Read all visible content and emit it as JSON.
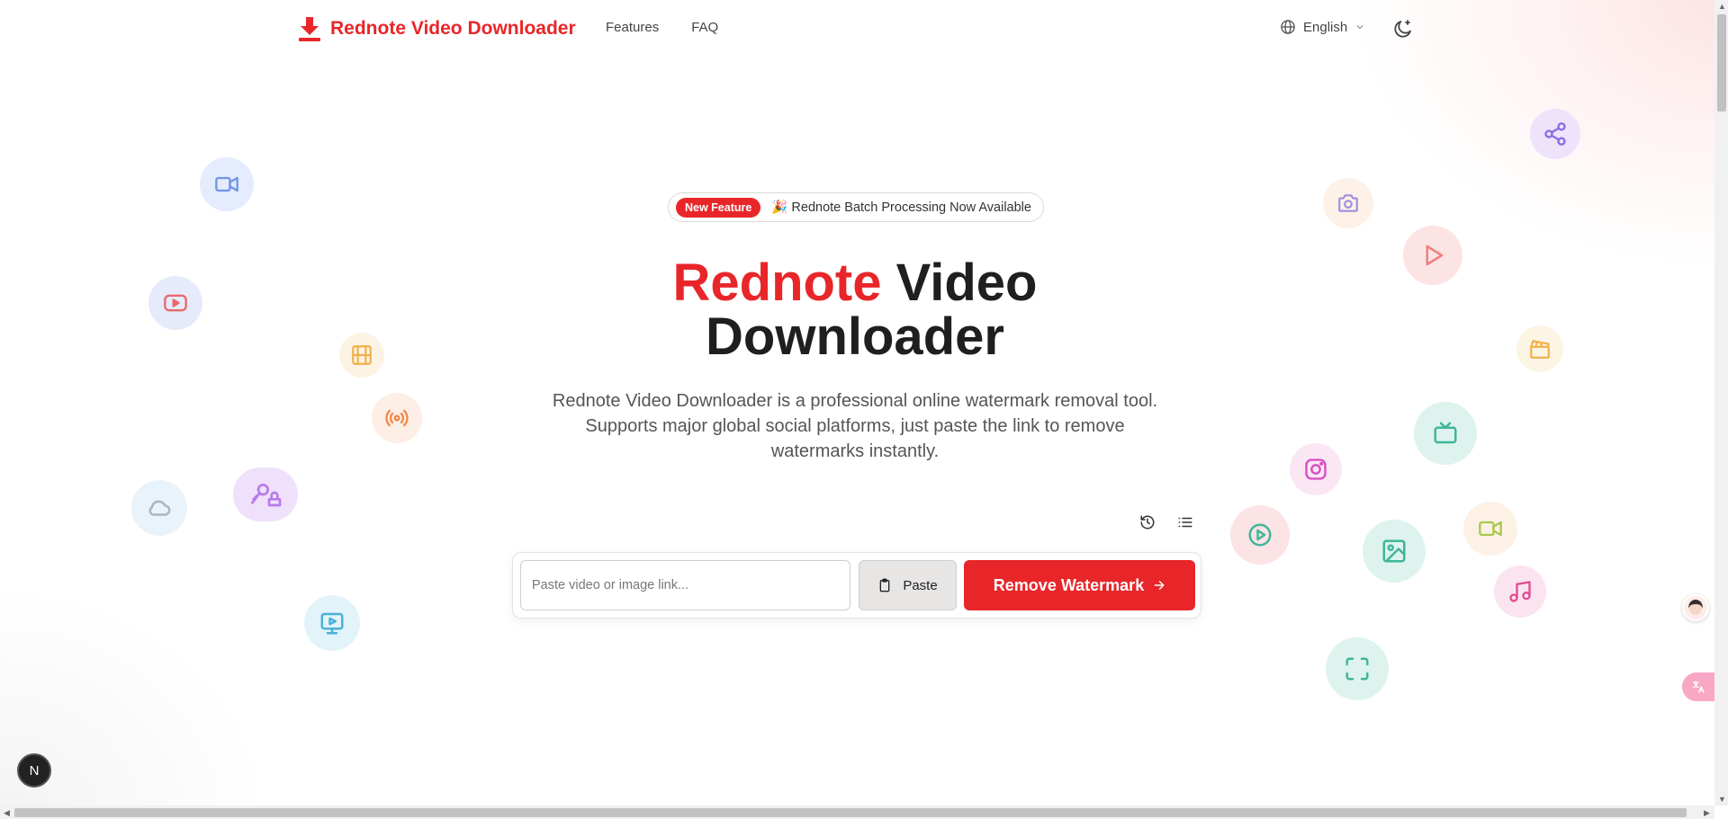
{
  "header": {
    "logo_text": "Rednote Video Downloader",
    "nav": [
      {
        "label": "Features"
      },
      {
        "label": "FAQ"
      }
    ],
    "language": "English"
  },
  "hero": {
    "badge_label": "New Feature",
    "badge_text": "🎉 Rednote Batch Processing Now Available",
    "title_red": "Rednote",
    "title_rest": " Video Downloader",
    "description": "Rednote Video Downloader is a professional online watermark removal tool. Supports major global social platforms, just paste the link to remove watermarks instantly."
  },
  "form": {
    "input_placeholder": "Paste video or image link...",
    "input_value": "",
    "paste_label": "Paste",
    "submit_label": "Remove Watermark"
  },
  "floating_button": {
    "label": "N"
  },
  "colors": {
    "brand": "#e8262a"
  }
}
